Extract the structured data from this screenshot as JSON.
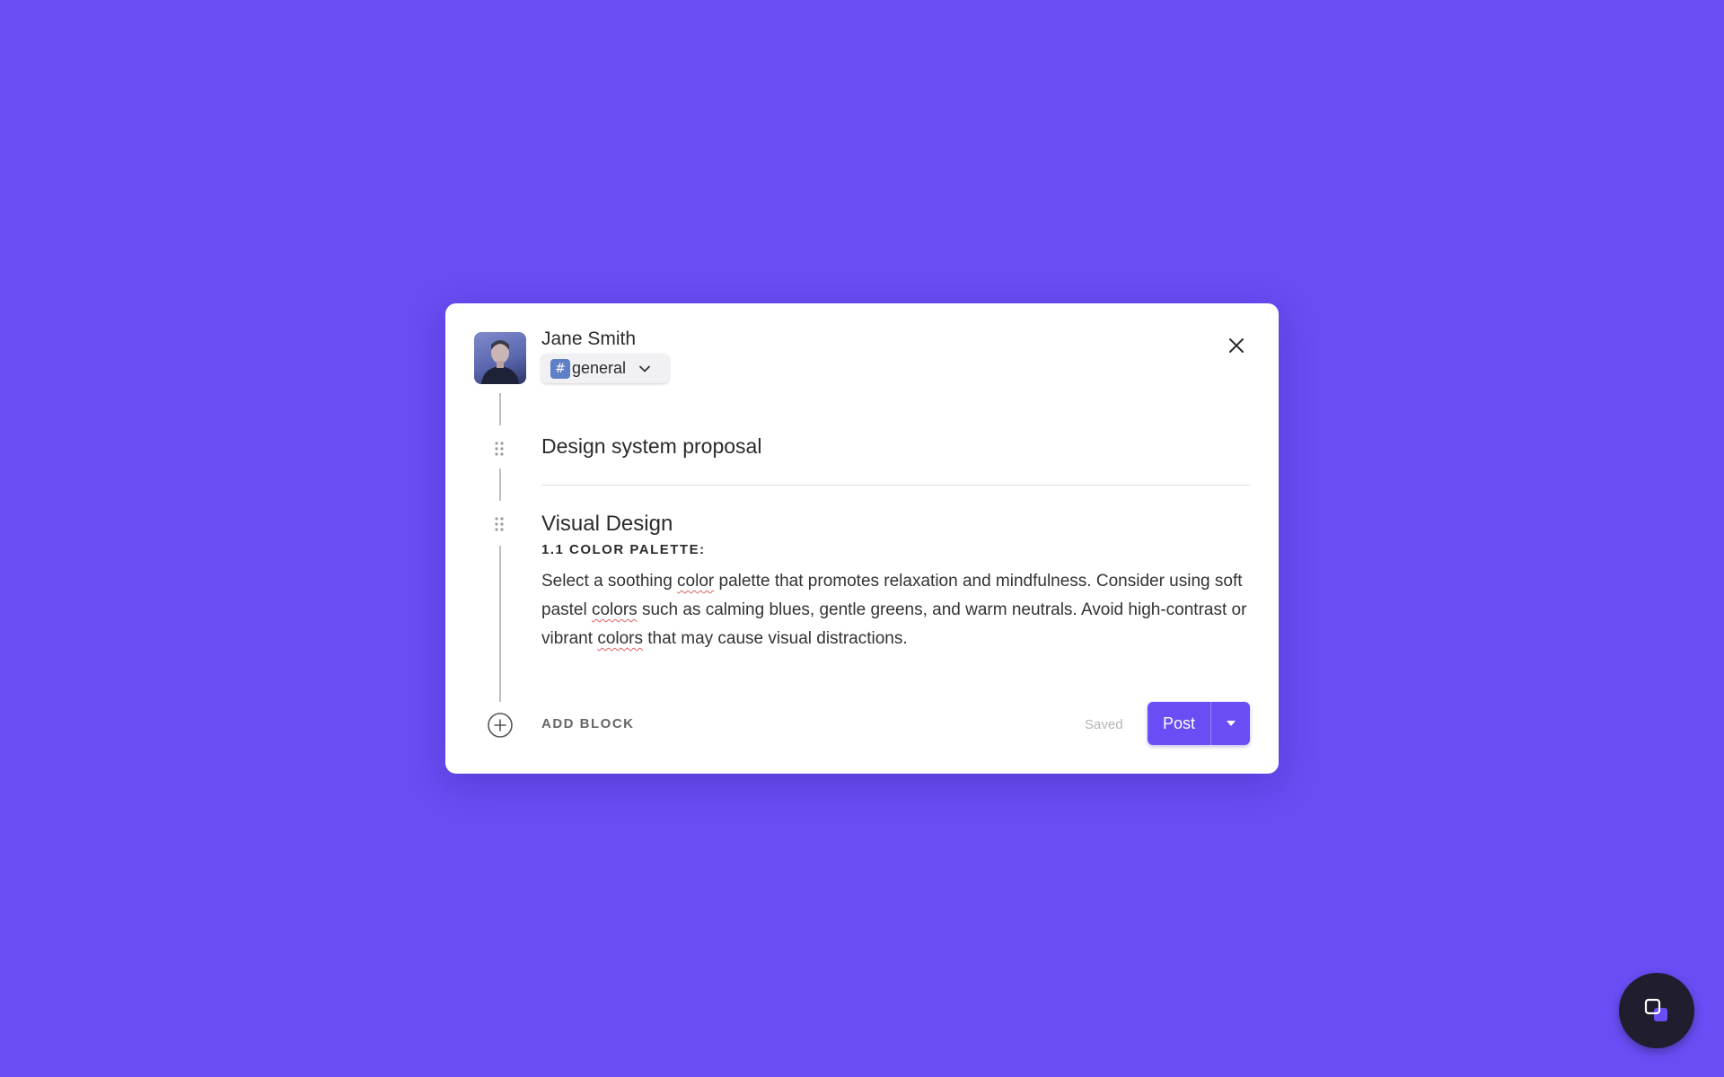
{
  "post": {
    "author_name": "Jane Smith",
    "channel": {
      "prefix_symbol": "#",
      "label": "general"
    },
    "title": "Design system proposal",
    "section_heading": "Visual Design",
    "subsection_heading": "1.1 COLOR PALETTE:",
    "body": {
      "seg1": "Select a soothing ",
      "w1": "color",
      "seg2": " palette that promotes relaxation and mindfulness. Consider using soft pastel ",
      "w2": "colors",
      "seg3": " such as calming blues, gentle greens, and warm neutrals. Avoid high-contrast or vibrant ",
      "w3": "colors",
      "seg4": " that may cause visual distractions."
    }
  },
  "footer": {
    "add_block_label": "ADD BLOCK",
    "status_text": "Saved",
    "post_label": "Post"
  },
  "icons": {
    "close": "close-icon",
    "drag": "drag-handle-icon",
    "add": "plus-circle-icon",
    "dropdown": "caret-down-icon",
    "channel_chevron": "chevron-down-icon",
    "fab": "copy-icon"
  },
  "colors": {
    "background": "#6a4df4",
    "accent": "#6a4df4",
    "fab": "#1f1d2e"
  }
}
